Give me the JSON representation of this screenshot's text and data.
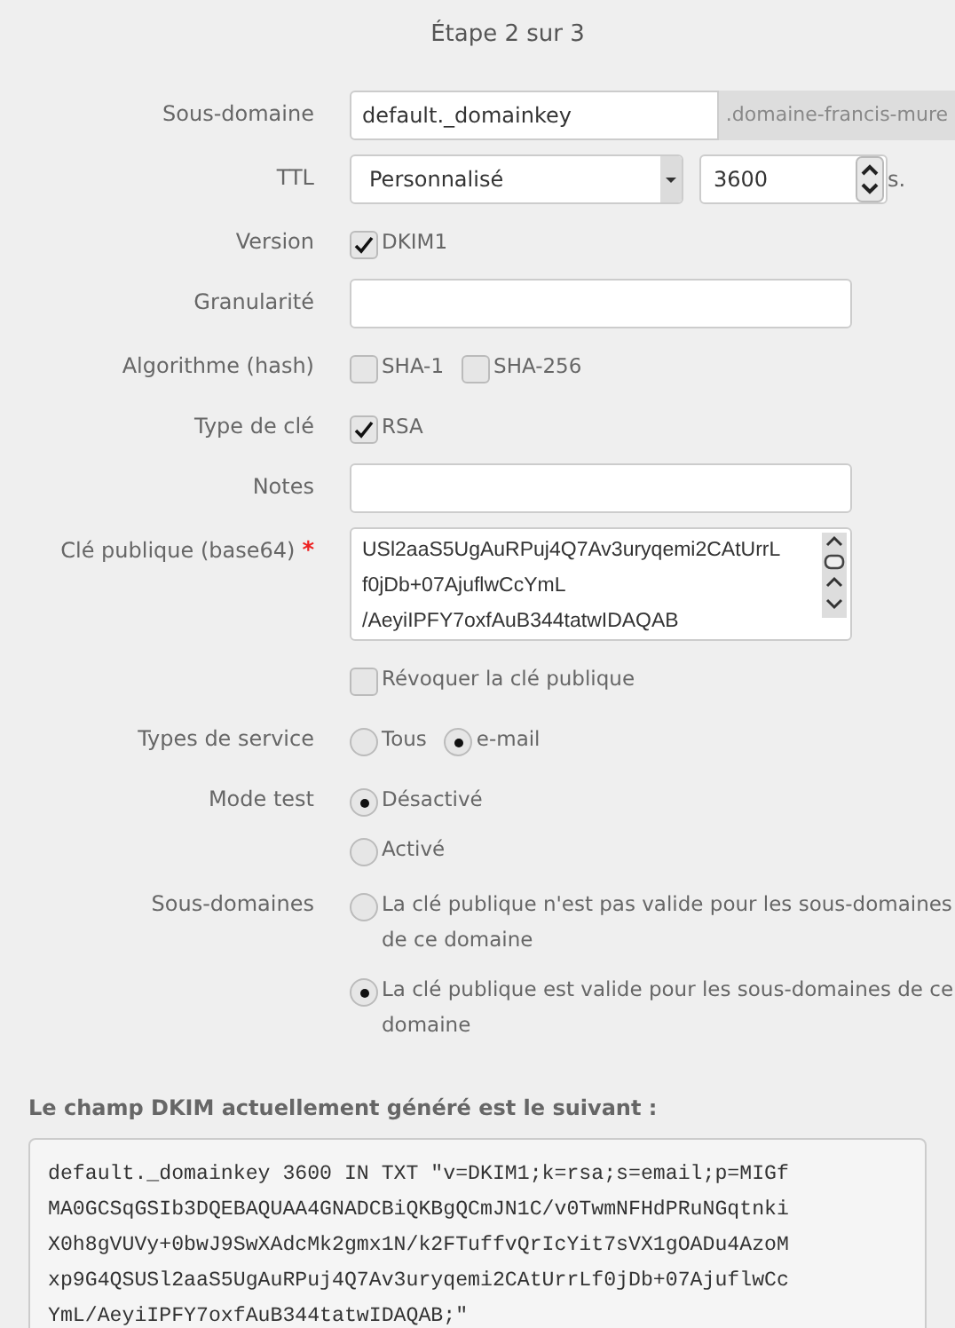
{
  "step_title": "Étape 2 sur 3",
  "fields": [
    {
      "kind": "text_addon",
      "label": "Sous-domaine",
      "value": "default._domainkey",
      "addon": ".domaine-francis-mure"
    },
    {
      "kind": "select_number",
      "label": "TTL",
      "value": "Personnalisé",
      "number": "3600",
      "unit": "s."
    },
    {
      "kind": "checks",
      "label": "Version",
      "options": [
        {
          "label": "DKIM1",
          "checked": true
        }
      ]
    },
    {
      "kind": "text",
      "label": "Granularité"
    },
    {
      "kind": "checks",
      "label": "Algorithme (hash)",
      "options": [
        {
          "label": "SHA-1",
          "checked": false
        },
        {
          "label": "SHA-256",
          "checked": false
        }
      ]
    },
    {
      "kind": "checks",
      "label": "Type de clé",
      "options": [
        {
          "label": "RSA",
          "checked": true
        }
      ]
    },
    {
      "kind": "text",
      "label": "Notes"
    },
    {
      "kind": "textarea",
      "label": "Clé publique (base64)",
      "marker": "*",
      "lines": [
        "USl2aaS5UgAuRPuj4Q7Av3uryqemi2CAtUrrL",
        "f0jDb+07AjuflwCcYmL",
        "/AeyiIPFY7oxfAuB344tatwIDAQAB"
      ]
    },
    {
      "kind": "checks",
      "options": [
        {
          "label": "Révoquer la clé publique",
          "checked": false
        }
      ]
    },
    {
      "kind": "radios",
      "label": "Types de service",
      "inline": true,
      "options": [
        {
          "label": "Tous",
          "selected": false
        },
        {
          "label": "e-mail",
          "selected": true
        }
      ]
    },
    {
      "kind": "radios",
      "label": "Mode test",
      "inline": false,
      "options": [
        {
          "label": "Désactivé",
          "selected": true
        },
        {
          "label": "Activé",
          "selected": false
        }
      ]
    },
    {
      "kind": "radios",
      "label": "Sous-domaines",
      "inline": false,
      "options": [
        {
          "label": "La clé publique n'est pas valide pour les sous-domaines de ce domaine",
          "selected": false
        },
        {
          "label": "La clé publique est valide pour les sous-domaines de ce domaine",
          "selected": true
        }
      ]
    }
  ],
  "result": {
    "heading": "Le champ DKIM actuellement généré est le suivant :",
    "lines": [
      "default._domainkey 3600 IN TXT \"v=DKIM1;k=rsa;s=email;p=MIGf",
      "MA0GCSqGSIb3DQEBAQUAA4GNADCBiQKBgQCmJN1C/v0TwmNFHdPRuNGqtnki",
      "X0h8gVUVy+0bwJ9SwXAdcMk2gmx1N/k2FTuffvQrIcYit7sVX1gOADu4AzoM",
      "xp9G4QSUSl2aaS5UgAuRPuj4Q7Av3uryqemi2CAtUrrLf0jDb+07AjuflwCc",
      "YmL/AeyiIPFY7oxfAuB344tatwIDAQAB;\""
    ]
  }
}
